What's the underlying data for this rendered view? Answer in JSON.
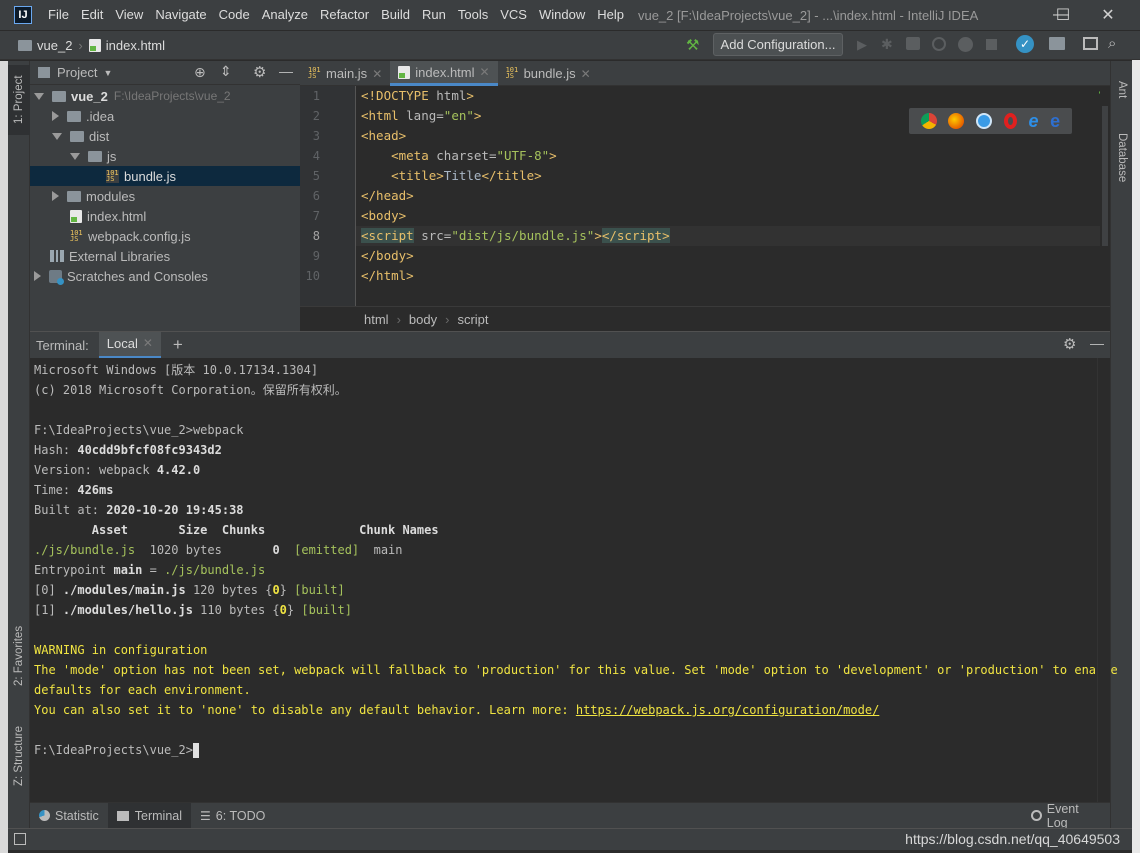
{
  "window": {
    "app_icon": "IJ",
    "title": "vue_2 [F:\\IdeaProjects\\vue_2] - ...\\index.html - IntelliJ IDEA",
    "menu": [
      "File",
      "Edit",
      "View",
      "Navigate",
      "Code",
      "Analyze",
      "Refactor",
      "Build",
      "Run",
      "Tools",
      "VCS",
      "Window",
      "Help"
    ],
    "controls": {
      "minimize": "—",
      "maximize": "☐",
      "close": "✕"
    }
  },
  "navbar": {
    "project": "vue_2",
    "file": "index.html",
    "add_configuration": "Add Configuration..."
  },
  "project_panel": {
    "title": "Project",
    "tree": [
      {
        "label": "vue_2",
        "extra": "F:\\IdeaProjects\\vue_2",
        "type": "folder",
        "state": "expanded"
      },
      {
        "label": ".idea",
        "type": "folder",
        "state": "collapsed"
      },
      {
        "label": "dist",
        "type": "folder",
        "state": "expanded"
      },
      {
        "label": "js",
        "type": "folder",
        "state": "expanded"
      },
      {
        "label": "bundle.js",
        "type": "js-file",
        "selected": true
      },
      {
        "label": "modules",
        "type": "folder",
        "state": "collapsed"
      },
      {
        "label": "index.html",
        "type": "html-file"
      },
      {
        "label": "webpack.config.js",
        "type": "js-file"
      },
      {
        "label": "External Libraries",
        "type": "library"
      },
      {
        "label": "Scratches and Consoles",
        "type": "scratch",
        "state": "collapsed"
      }
    ]
  },
  "side_tabs": {
    "left": [
      "1: Project",
      "2: Favorites",
      "Z: Structure"
    ],
    "right": [
      "Ant",
      "Database"
    ]
  },
  "editor": {
    "tabs": [
      {
        "label": "main.js",
        "active": false
      },
      {
        "label": "index.html",
        "active": true
      },
      {
        "label": "bundle.js",
        "active": false
      }
    ],
    "line_numbers": [
      "1",
      "2",
      "3",
      "4",
      "5",
      "6",
      "7",
      "8",
      "9",
      "10"
    ],
    "breadcrumbs": [
      "html",
      "body",
      "script"
    ],
    "browser_icons": [
      "chrome-icon",
      "firefox-icon",
      "safari-icon",
      "opera-icon",
      "ie-icon",
      "edge-icon"
    ]
  },
  "terminal": {
    "label": "Terminal:",
    "tab": "Local",
    "lines": {
      "l1": "Microsoft Windows [版本 10.0.17134.1304]",
      "l2": "(c) 2018 Microsoft Corporation。保留所有权利。",
      "l3": "F:\\IdeaProjects\\vue_2>webpack",
      "hash_label": "Hash: ",
      "hash_value": "40cdd9bfcf08fc9343d2",
      "version_label": "Version: webpack ",
      "version_value": "4.42.0",
      "time_label": "Time: ",
      "time_value": "426ms",
      "built_label": "Built at: ",
      "built_value": "2020-10-20 19:45:38",
      "table_header": "        Asset       Size  Chunks             Chunk Names",
      "row_asset": "./js/bundle.js",
      "row_size": "  1020 bytes       ",
      "row_chunk": "0",
      "row_emitted": "  [emitted]",
      "row_name": "  main",
      "entry_label": "Entrypoint ",
      "entry_main": "main",
      "entry_eq": " = ",
      "entry_file": "./js/bundle.js",
      "m0_idx": "[0] ",
      "m0_path": "./modules/main.js",
      "m0_size": " 120 bytes {",
      "m0_chunk": "0",
      "m0_close": "} ",
      "m0_built": "[built]",
      "m1_idx": "[1] ",
      "m1_path": "./modules/hello.js",
      "m1_size": " 110 bytes {",
      "m1_chunk": "0",
      "m1_close": "} ",
      "m1_built": "[built]",
      "warn1": "WARNING in configuration",
      "warn2": "The 'mode' option has not been set, webpack will fallback to 'production' for this value. Set 'mode' option to 'development' or 'production' to enable",
      "warn3": "defaults for each environment.",
      "warn4": "You can also set it to 'none' to disable any default behavior. Learn more: ",
      "warn_link": "https://webpack.js.org/configuration/mode/",
      "prompt": "F:\\IdeaProjects\\vue_2>"
    }
  },
  "bottom_tabs": [
    {
      "label": "Statistic",
      "active": false
    },
    {
      "label": "Terminal",
      "active": true
    },
    {
      "label": "6: TODO",
      "active": false
    }
  ],
  "event_log": "Event Log",
  "watermark": "https://blog.csdn.net/qq_40649503",
  "colors": {
    "accent": "#4a88c7",
    "tag": "#e8bf6a",
    "string": "#a5c25c",
    "warning": "#f0e442"
  }
}
